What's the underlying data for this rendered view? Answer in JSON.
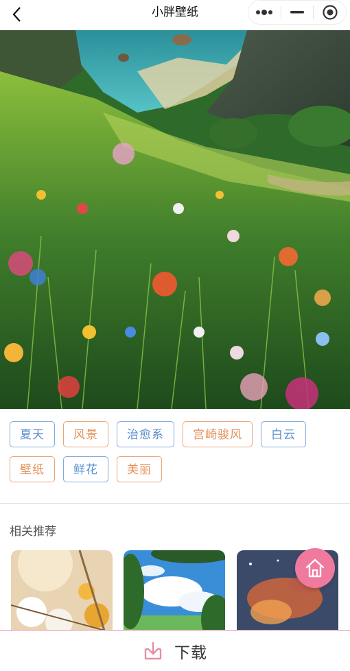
{
  "nav": {
    "title": "小胖壁纸",
    "back_icon": "chevron-left-icon",
    "capsule_icons": [
      "more-dots-icon",
      "minimize-icon",
      "target-icon"
    ]
  },
  "hero": {
    "description_icon": "wallpaper-image"
  },
  "tags": [
    {
      "label": "夏天",
      "color": "#5a8fd0"
    },
    {
      "label": "风景",
      "color": "#e4915a"
    },
    {
      "label": "治愈系",
      "color": "#5a8fd0"
    },
    {
      "label": "宫崎骏风",
      "color": "#e4915a"
    },
    {
      "label": "白云",
      "color": "#5a8fd0"
    },
    {
      "label": "壁纸",
      "color": "#e4915a"
    },
    {
      "label": "鲜花",
      "color": "#5a8fd0"
    },
    {
      "label": "美丽",
      "color": "#e4915a"
    }
  ],
  "related": {
    "title": "相关推荐",
    "items": [
      "recommend-thumbnail-1",
      "recommend-thumbnail-2",
      "recommend-thumbnail-3"
    ]
  },
  "home_fab": {
    "icon": "home-icon",
    "color": "#f07a9d"
  },
  "bottom": {
    "download_label": "下载",
    "icon": "download-icon",
    "accent": "#e58fa6"
  }
}
